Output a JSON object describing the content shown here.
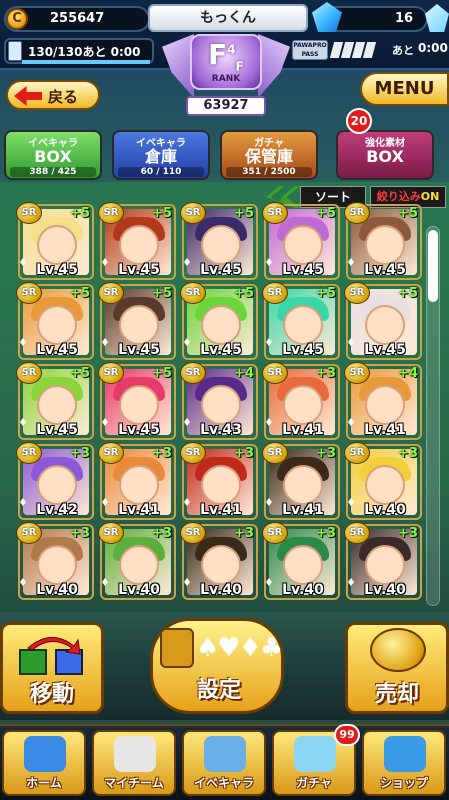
{
  "header": {
    "coins": "255647",
    "coin_glyph": "C",
    "player_name": "もっくん",
    "gems": "16",
    "stamina_text": "130/130あと 0:00",
    "stamina_fill": 1.0,
    "pass_label": "あと",
    "pass_time": "0:00",
    "pass_icon_text": "PAWAPRO PASS"
  },
  "rank": {
    "letter": "F",
    "superscript": "4",
    "sub": "F",
    "label": "RANK",
    "score": "63927"
  },
  "nav_top": {
    "back_label": "戻る",
    "menu_label": "MENU"
  },
  "tabs": [
    {
      "top": "イベキャラ",
      "main": "BOX",
      "count": "388 / 425",
      "active": true
    },
    {
      "top": "イベキャラ",
      "main": "倉庫",
      "count": "60 / 110",
      "active": false
    },
    {
      "top": "ガチャ",
      "main": "保管庫",
      "count": "351 / 2500",
      "active": false
    },
    {
      "top": "強化素材",
      "main": "BOX",
      "count": "",
      "active": false
    }
  ],
  "enhance_badge": "20",
  "toolbar": {
    "sort_label": "ソート",
    "filter_label": "絞り込み",
    "filter_state": "ON"
  },
  "grid": {
    "rank_badge": "SR",
    "cards": [
      {
        "plus": "+5",
        "lv": "Lv.45",
        "hair": "#f2e08a"
      },
      {
        "plus": "+5",
        "lv": "Lv.45",
        "hair": "#b03a1a"
      },
      {
        "plus": "+5",
        "lv": "Lv.45",
        "hair": "#3a2a6a"
      },
      {
        "plus": "+5",
        "lv": "Lv.45",
        "hair": "#c06ad6"
      },
      {
        "plus": "+5",
        "lv": "Lv.45",
        "hair": "#8a5a3a"
      },
      {
        "plus": "+5",
        "lv": "Lv.45",
        "hair": "#e89a3a"
      },
      {
        "plus": "+5",
        "lv": "Lv.45",
        "hair": "#5a3a2a"
      },
      {
        "plus": "+5",
        "lv": "Lv.45",
        "hair": "#6ad63a"
      },
      {
        "plus": "+5",
        "lv": "Lv.45",
        "hair": "#3ad6a8"
      },
      {
        "plus": "+5",
        "lv": "Lv.45",
        "hair": "#e8e0e0"
      },
      {
        "plus": "+5",
        "lv": "Lv.45",
        "hair": "#8ad63a"
      },
      {
        "plus": "+5",
        "lv": "Lv.45",
        "hair": "#e83a6a"
      },
      {
        "plus": "+4",
        "lv": "Lv.43",
        "hair": "#5a2a8a"
      },
      {
        "plus": "+3",
        "lv": "Lv.41",
        "hair": "#e86a3a"
      },
      {
        "plus": "+4",
        "lv": "Lv.41",
        "hair": "#e89a3a"
      },
      {
        "plus": "+3",
        "lv": "Lv.42",
        "hair": "#8a5ad6"
      },
      {
        "plus": "+3",
        "lv": "Lv.41",
        "hair": "#e88a3a"
      },
      {
        "plus": "+3",
        "lv": "Lv.41",
        "hair": "#c02a1a"
      },
      {
        "plus": "+3",
        "lv": "Lv.41",
        "hair": "#3a2a1a"
      },
      {
        "plus": "+3",
        "lv": "Lv.40",
        "hair": "#f2d03a"
      },
      {
        "plus": "+3",
        "lv": "Lv.40",
        "hair": "#b07a4a"
      },
      {
        "plus": "+3",
        "lv": "Lv.40",
        "hair": "#5ab03a"
      },
      {
        "plus": "+3",
        "lv": "Lv.40",
        "hair": "#3a2a1a"
      },
      {
        "plus": "+3",
        "lv": "Lv.40",
        "hair": "#2a8a4a"
      },
      {
        "plus": "+3",
        "lv": "Lv.40",
        "hair": "#3a2a2a"
      }
    ]
  },
  "actions": {
    "move_label": "移動",
    "set_label": "設定",
    "sell_label": "売却",
    "suits": "♠♥♦♣"
  },
  "bottom_nav": [
    {
      "label": "ホーム",
      "icon": "home-icon",
      "color": "#3a8ae6"
    },
    {
      "label": "マイチーム",
      "icon": "team-icon",
      "color": "#e6e6e6"
    },
    {
      "label": "イベキャラ",
      "icon": "event-chara-icon",
      "color": "#6ab0e6"
    },
    {
      "label": "ガチャ",
      "icon": "gacha-icon",
      "color": "#8ad6f2"
    },
    {
      "label": "ショップ",
      "icon": "shop-icon",
      "color": "#3a9ae6"
    }
  ],
  "gacha_badge": "99"
}
